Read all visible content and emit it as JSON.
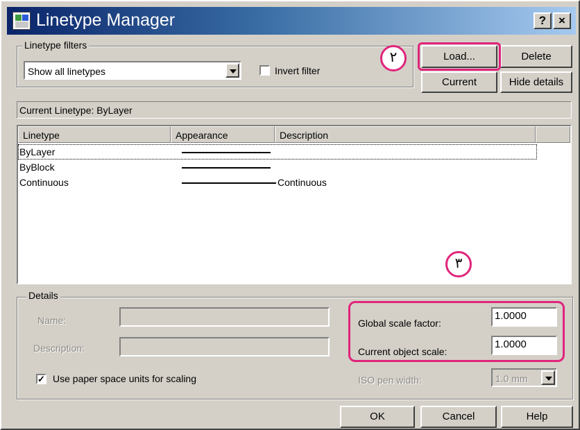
{
  "window": {
    "title": "Linetype Manager",
    "help_button": "?",
    "close_button": "×",
    "title_icon": "autocad-app-icon"
  },
  "filters": {
    "legend": "Linetype filters",
    "selected": "Show all linetypes",
    "invert_label": "Invert filter",
    "invert_checked": false
  },
  "buttons": {
    "load": "Load...",
    "delete": "Delete",
    "current": "Current",
    "hide_details": "Hide details",
    "ok": "OK",
    "cancel": "Cancel",
    "help": "Help"
  },
  "current_linetype": "Current Linetype:  ByLayer",
  "table": {
    "headers": [
      "Linetype",
      "Appearance",
      "Description"
    ],
    "rows": [
      {
        "name": "ByLayer",
        "description": ""
      },
      {
        "name": "ByBlock",
        "description": ""
      },
      {
        "name": "Continuous",
        "description": "Continuous"
      }
    ],
    "selected_row": 0
  },
  "details": {
    "legend": "Details",
    "name_label": "Name:",
    "name_value": "",
    "description_label": "Description:",
    "description_value": "",
    "paper_space_label": "Use paper space units for scaling",
    "paper_space_checked": true,
    "global_scale_label": "Global scale factor:",
    "global_scale_value": "1.0000",
    "object_scale_label": "Current object scale:",
    "object_scale_value": "1.0000",
    "iso_pen_label": "ISO pen width:",
    "iso_pen_value": "1.0 mm"
  },
  "annotations": {
    "step2": "۲",
    "step3": "۳",
    "highlight_color": "#e0247b"
  },
  "colors": {
    "title_gradient_start": "#0a246a",
    "title_gradient_end": "#a6caf0",
    "dialog_face": "#d4d0c8"
  }
}
